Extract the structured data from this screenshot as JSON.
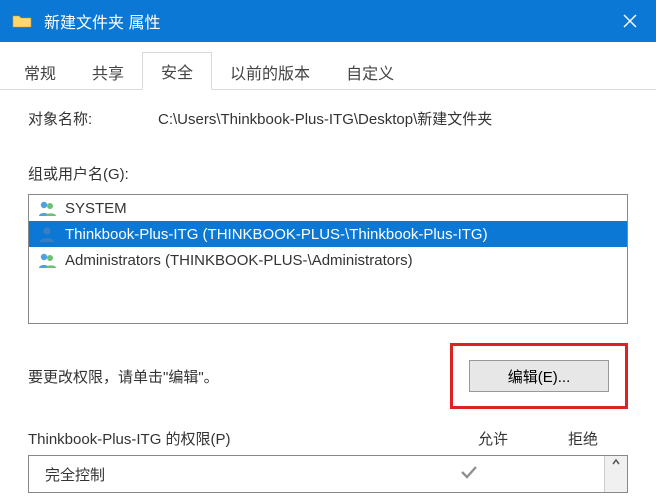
{
  "titlebar": {
    "title": "新建文件夹 属性"
  },
  "tabs": [
    "常规",
    "共享",
    "安全",
    "以前的版本",
    "自定义"
  ],
  "active_tab_index": 2,
  "object": {
    "label": "对象名称:",
    "path": "C:\\Users\\Thinkbook-Plus-ITG\\Desktop\\新建文件夹"
  },
  "group": {
    "label": "组或用户名(G):",
    "items": [
      {
        "icon": "group",
        "text": "SYSTEM",
        "selected": false
      },
      {
        "icon": "user",
        "text": "Thinkbook-Plus-ITG (THINKBOOK-PLUS-\\Thinkbook-Plus-ITG)",
        "selected": true
      },
      {
        "icon": "group",
        "text": "Administrators (THINKBOOK-PLUS-\\Administrators)",
        "selected": false
      }
    ]
  },
  "edit": {
    "hint": "要更改权限，请单击\"编辑\"。",
    "button": "编辑(E)..."
  },
  "perm": {
    "title": "Thinkbook-Plus-ITG 的权限(P)",
    "col_allow": "允许",
    "col_deny": "拒绝",
    "rows": [
      {
        "name": "完全控制",
        "allow": true,
        "deny": false
      }
    ]
  }
}
